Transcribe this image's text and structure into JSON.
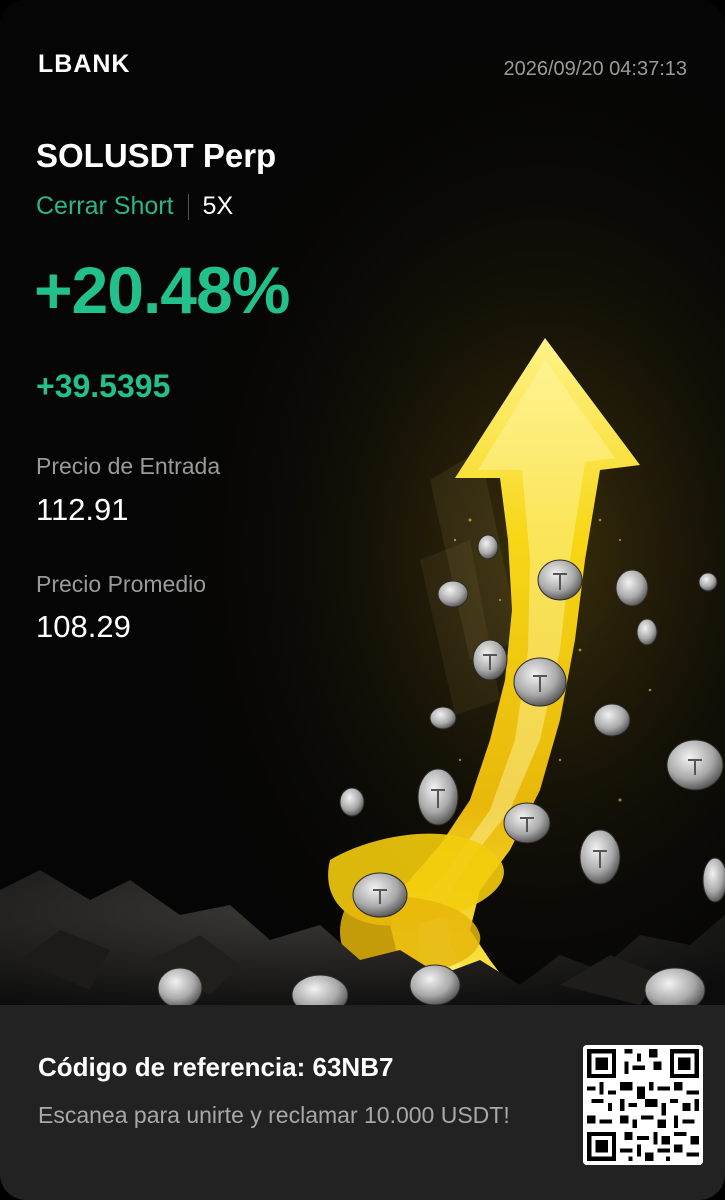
{
  "brand": {
    "logo_text": "LBANK"
  },
  "header": {
    "timestamp": "2026/09/20 04:37:13"
  },
  "position": {
    "pair": "SOLUSDT Perp",
    "side": "Cerrar Short",
    "leverage": "5X",
    "pnl_percent": "+20.48%",
    "pnl_amount": "+39.5395"
  },
  "prices": {
    "entry_label": "Precio de Entrada",
    "entry_value": "112.91",
    "average_label": "Precio Promedio",
    "average_value": "108.29"
  },
  "footer": {
    "referral": "Código de referencia: 63NB7",
    "description": "Escanea para unirte y reclamar 10.000 USDT!",
    "qr_icon": "qr-code-icon"
  },
  "colors": {
    "profit_green": "#22c08d",
    "side_green": "#2bb58a",
    "background": "#050505",
    "footer_bg": "#222222",
    "arrow_gold": "#f5d20a"
  }
}
